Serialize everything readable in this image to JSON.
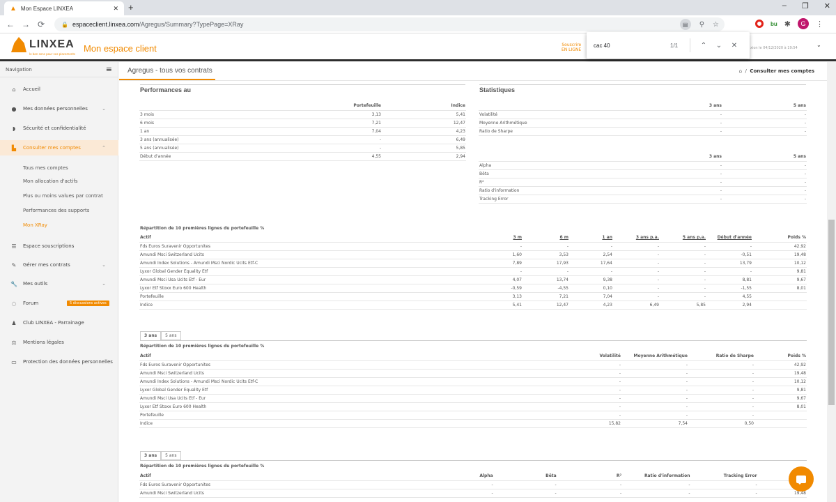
{
  "browser": {
    "tab_title": "Mon Espace LINXEA",
    "url_host": "espaceclient.linxea.com",
    "url_path": "/Agregus/Summary?TypePage=XRay",
    "profile_initial": "G",
    "ext_bu": "bu"
  },
  "find": {
    "query": "cac 40",
    "count": "1/1"
  },
  "header": {
    "logo": "LINXEA",
    "logo_tagline": "le bon sens pour vos placements",
    "espace": "Mon espace client",
    "souscrire_1": "Souscrire",
    "souscrire_2": "EN LIGNE",
    "last_connection": "xion le 04/12/2020 à 19:54"
  },
  "sidebar": {
    "nav_label": "Navigation",
    "items": [
      {
        "label": "Accueil",
        "icon": "home-icon"
      },
      {
        "label": "Mes données personnelles",
        "icon": "user-icon"
      },
      {
        "label": "Sécurité et confidentialité",
        "icon": "shield-icon"
      },
      {
        "label": "Consulter mes comptes",
        "icon": "chart-icon"
      },
      {
        "label": "Espace souscriptions",
        "icon": "list-icon"
      },
      {
        "label": "Gérer mes contrats",
        "icon": "edit-icon"
      },
      {
        "label": "Mes outils",
        "icon": "wrench-icon"
      },
      {
        "label": "Forum",
        "icon": "chat-icon"
      },
      {
        "label": "Club LINXEA - Parrainage",
        "icon": "group-icon"
      },
      {
        "label": "Mentions légales",
        "icon": "scale-icon"
      },
      {
        "label": "Protection des données personnelles",
        "icon": "id-card-icon"
      }
    ],
    "subitems": [
      "Tous mes comptes",
      "Mon allocation d'actifs",
      "Plus ou moins values par contrat",
      "Performances des supports",
      "Mon XRay"
    ],
    "forum_badge": "5 discussions actives"
  },
  "main": {
    "title": "Agregus - tous vos contrats",
    "breadcrumb": "Consulter mes comptes"
  },
  "perf": {
    "title": "Performances au",
    "headers": [
      "Portefeuille",
      "Indice"
    ],
    "rows": [
      [
        "3 mois",
        "3,13",
        "5,41"
      ],
      [
        "6 mois",
        "7,21",
        "12,47"
      ],
      [
        "1 an",
        "7,04",
        "4,23"
      ],
      [
        "3 ans (annualisée)",
        "-",
        "6,49"
      ],
      [
        "5 ans (annualisée)",
        "-",
        "5,85"
      ],
      [
        "Début d'année",
        "4,55",
        "2,94"
      ]
    ]
  },
  "stats": {
    "title": "Statistiques",
    "headers": [
      "3 ans",
      "5 ans"
    ],
    "rows1": [
      [
        "Volatilité",
        "-",
        "-"
      ],
      [
        "Moyenne Arithmétique",
        "-",
        "-"
      ],
      [
        "Ratio de Sharpe",
        "-",
        "-"
      ]
    ],
    "rows2": [
      [
        "Alpha",
        "-",
        "-"
      ],
      [
        "Bêta",
        "-",
        "-"
      ],
      [
        "R²",
        "-",
        "-"
      ],
      [
        "Ratio d'information",
        "-",
        "-"
      ],
      [
        "Tracking Error",
        "-",
        "-"
      ]
    ]
  },
  "rep1": {
    "caption": "Répartition de 10 premières lignes du portefeuille %",
    "headers": [
      "Actif",
      "3 m",
      "6 m",
      "1 an",
      "3 ans p.a.",
      "5 ans p.a.",
      "Début d'année",
      "Poids %"
    ],
    "rows": [
      [
        "Fds Euros Suravenir Opportunites",
        "-",
        "-",
        "-",
        "-",
        "-",
        "-",
        "42,92"
      ],
      [
        "Amundi Msci Switzerland Ucits",
        "1,60",
        "3,53",
        "2,54",
        "-",
        "-",
        "-0,51",
        "19,48"
      ],
      [
        "Amundi Index Solutions - Amundi Msci Nordic Ucits Etf-C",
        "7,89",
        "17,93",
        "17,64",
        "-",
        "-",
        "13,79",
        "10,12"
      ],
      [
        "Lyxor Global Gender Equality Etf",
        "-",
        "-",
        "-",
        "-",
        "-",
        "-",
        "9,81"
      ],
      [
        "Amundi Msci Usa Ucits Etf - Eur",
        "4,07",
        "13,74",
        "9,38",
        "-",
        "-",
        "8,81",
        "9,67"
      ],
      [
        "Lyxor Etf Stoxx Euro 600 Health",
        "-0,59",
        "-4,55",
        "0,10",
        "-",
        "-",
        "-1,55",
        "8,01"
      ],
      [
        "Portefeuille",
        "3,13",
        "7,21",
        "7,04",
        "-",
        "-",
        "4,55",
        ""
      ],
      [
        "Indice",
        "5,41",
        "12,47",
        "4,23",
        "6,49",
        "5,85",
        "2,94",
        ""
      ]
    ]
  },
  "period_tabs": [
    "3 ans",
    "5 ans"
  ],
  "rep2": {
    "caption": "Répartition de 10 premières lignes du portefeuille %",
    "headers": [
      "Actif",
      "Volatilité",
      "Moyenne Arithmétique",
      "Ratio de Sharpe",
      "Poids %"
    ],
    "rows": [
      [
        "Fds Euros Suravenir Opportunites",
        "-",
        "-",
        "-",
        "42,92"
      ],
      [
        "Amundi Msci Switzerland Ucits",
        "-",
        "-",
        "-",
        "19,48"
      ],
      [
        "Amundi Index Solutions - Amundi Msci Nordic Ucits Etf-C",
        "-",
        "-",
        "-",
        "10,12"
      ],
      [
        "Lyxor Global Gender Equality Etf",
        "-",
        "-",
        "-",
        "9,81"
      ],
      [
        "Amundi Msci Usa Ucits Etf - Eur",
        "-",
        "-",
        "-",
        "9,67"
      ],
      [
        "Lyxor Etf Stoxx Euro 600 Health",
        "-",
        "-",
        "-",
        "8,01"
      ],
      [
        "Portefeuille",
        "-",
        "-",
        "-",
        ""
      ],
      [
        "Indice",
        "15,82",
        "7,54",
        "0,50",
        ""
      ]
    ]
  },
  "rep3": {
    "caption": "Répartition de 10 premières lignes du portefeuille %",
    "headers": [
      "Actif",
      "Alpha",
      "Bêta",
      "R²",
      "Ratio d'information",
      "Tracking Error",
      "P"
    ],
    "rows": [
      [
        "Fds Euros Suravenir Opportunites",
        "-",
        "-",
        "-",
        "-",
        "-",
        ""
      ],
      [
        "Amundi Msci Switzerland Ucits",
        "-",
        "-",
        "-",
        "-",
        "-",
        "19,48"
      ]
    ]
  }
}
